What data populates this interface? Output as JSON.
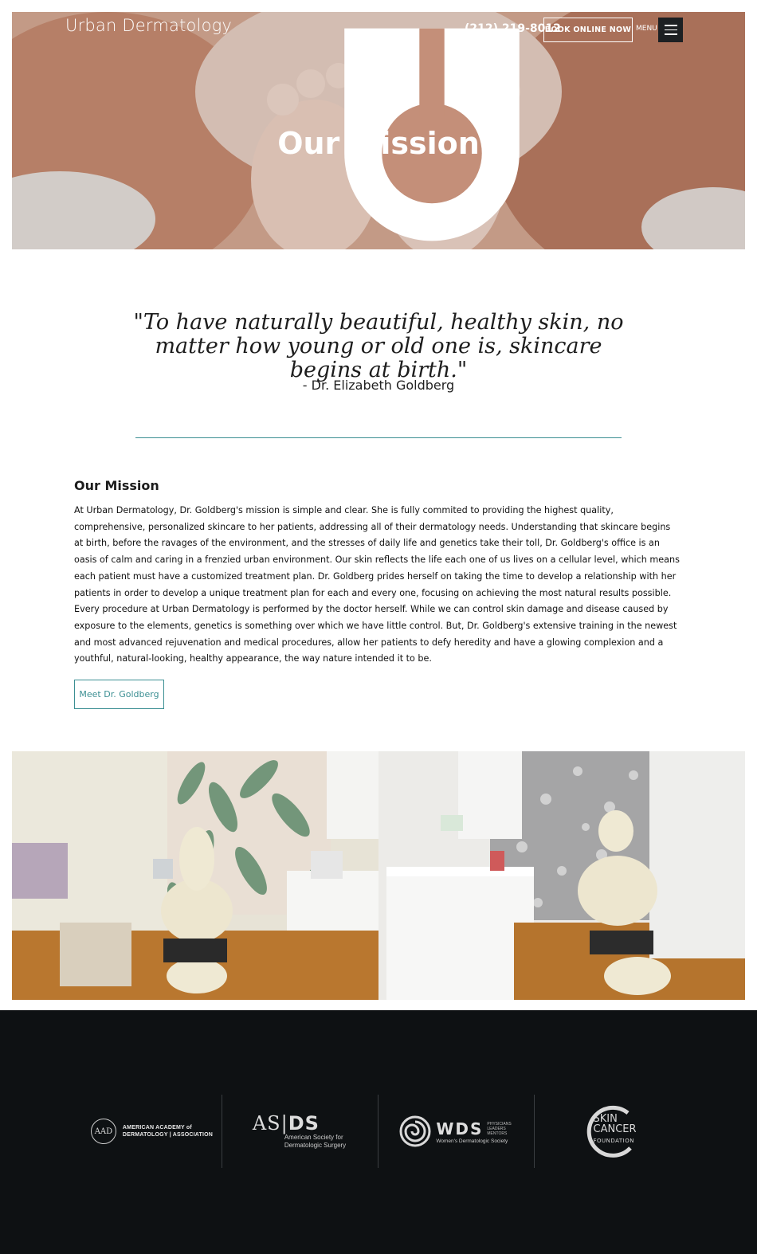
{
  "header": {
    "logo_text": "Urban Dermatology",
    "phone": "(212) 219-8012",
    "book_label": "BOOK ONLINE NOW",
    "menu_label": "MENU"
  },
  "hero": {
    "title": "Our Mission"
  },
  "quote": {
    "text": "\"To have naturally beautiful, healthy skin, no matter how young or old one is, skincare begins at birth.\"",
    "author": "- Dr. Elizabeth Goldberg"
  },
  "mission": {
    "title": "Our Mission",
    "body": "At Urban Dermatology, Dr. Goldberg's mission is simple and clear. She is fully commited to providing the highest quality, comprehensive, personalized skincare to her patients, addressing all of their dermatology needs. Understanding that skincare begins at birth, before the ravages of the environment, and the stresses of daily life and genetics take their toll, Dr. Goldberg's office is an oasis of calm and caring in a frenzied urban environment. Our skin reflects the life each one of us lives on a cellular level, which means each patient must have a customized treatment plan. Dr. Goldberg prides herself on taking the time to develop a relationship with her patients in order to develop a unique treatment plan for each and every one, focusing on achieving the most natural results possible. Every procedure at Urban Dermatology is performed by the doctor herself. While we can control skin damage and disease caused by exposure to the elements, genetics is something over which we have little control. But, Dr. Goldberg's extensive training in the newest and most advanced rejuvenation and medical procedures, allow her patients to defy heredity and have a glowing complexion and a youthful, natural-looking, healthy appearance, the way nature intended it to be.",
    "cta_label": "Meet Dr. Goldberg"
  },
  "footer": {
    "aad": {
      "seal": "AAD",
      "line1": "AMERICAN ACADEMY of",
      "line2": "DERMATOLOGY | ASSOCIATION"
    },
    "asds": {
      "mark_a": "AS",
      "mark_b": "DS",
      "line1": "American Society for",
      "line2": "Dermatologic Surgery"
    },
    "wds": {
      "mark": "WDS",
      "tag1": "PHYSICIANS",
      "tag2": "LEADERS",
      "tag3": "MENTORS",
      "sub": "Women's Dermatologic Society"
    },
    "scf": {
      "line1": "SKIN",
      "line2": "CANCER",
      "line3": "FOUNDATION"
    }
  },
  "colors": {
    "accent": "#3c8f93",
    "footer_bg": "#0e1113",
    "menu_bg": "#1d2023"
  }
}
